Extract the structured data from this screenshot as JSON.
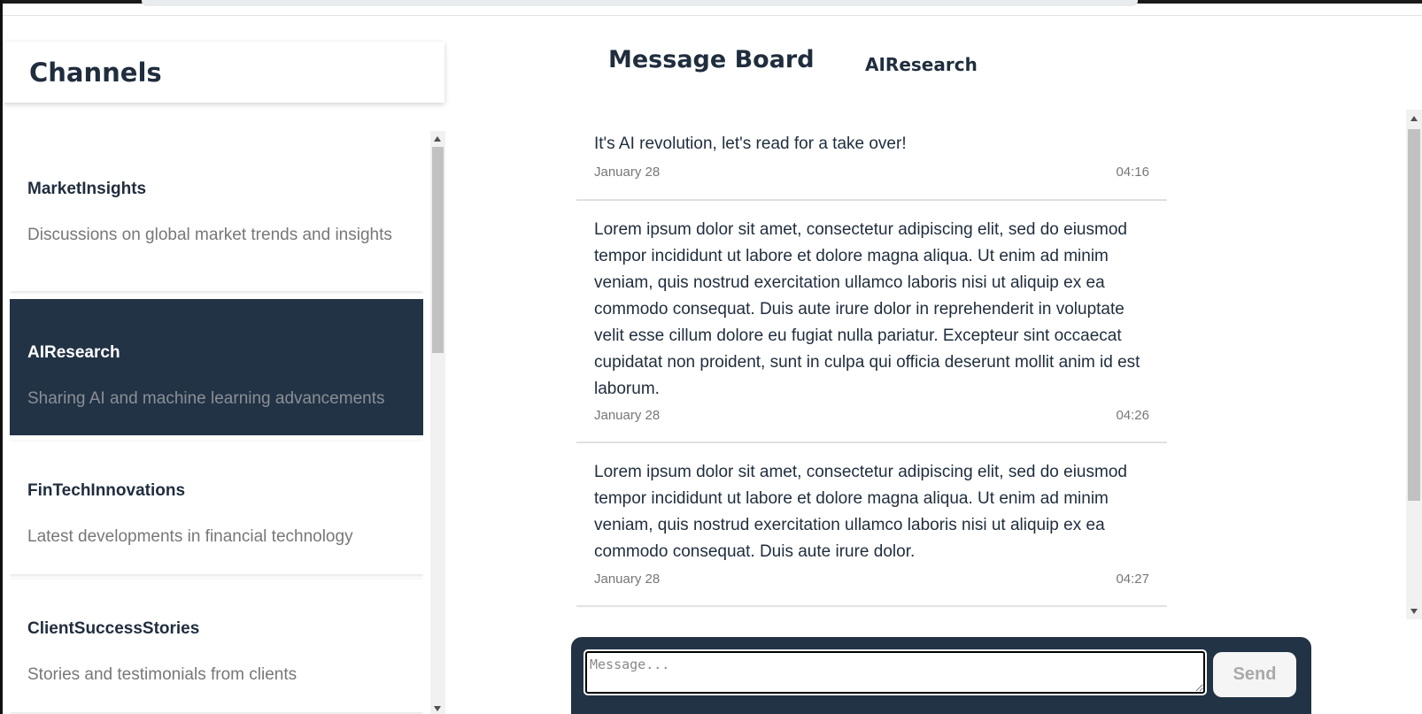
{
  "sidebar": {
    "title": "Channels",
    "items": [
      {
        "name": "MarketInsights",
        "description": "Discussions on global market trends and insights"
      },
      {
        "name": "AIResearch",
        "description": "Sharing AI and machine learning advancements"
      },
      {
        "name": "FinTechInnovations",
        "description": "Latest developments in financial technology"
      },
      {
        "name": "ClientSuccessStories",
        "description": "Stories and testimonials from clients"
      }
    ],
    "active_index": 1
  },
  "main": {
    "title": "Message Board",
    "active_channel": "AIResearch",
    "messages": [
      {
        "text": "It's AI revolution, let's read for a take over!",
        "date": "January 28",
        "time": "04:16"
      },
      {
        "text": "Lorem ipsum dolor sit amet, consectetur adipiscing elit, sed do eiusmod tempor incididunt ut labore et dolore magna aliqua. Ut enim ad minim veniam, quis nostrud exercitation ullamco laboris nisi ut aliquip ex ea commodo consequat. Duis aute irure dolor in reprehenderit in voluptate velit esse cillum dolore eu fugiat nulla pariatur. Excepteur sint occaecat cupidatat non proident, sunt in culpa qui officia deserunt mollit anim id est laborum.",
        "date": "January 28",
        "time": "04:26"
      },
      {
        "text": "Lorem ipsum dolor sit amet, consectetur adipiscing elit, sed do eiusmod tempor incididunt ut labore et dolore magna aliqua. Ut enim ad minim veniam, quis nostrud exercitation ullamco laboris nisi ut aliquip ex ea commodo consequat. Duis aute irure dolor.",
        "date": "January 28",
        "time": "04:27"
      }
    ]
  },
  "composer": {
    "placeholder": "Message...",
    "send_label": "Send"
  },
  "colors": {
    "accent_dark": "#223345",
    "text_primary": "#1f2d3d",
    "text_muted": "#777777"
  }
}
